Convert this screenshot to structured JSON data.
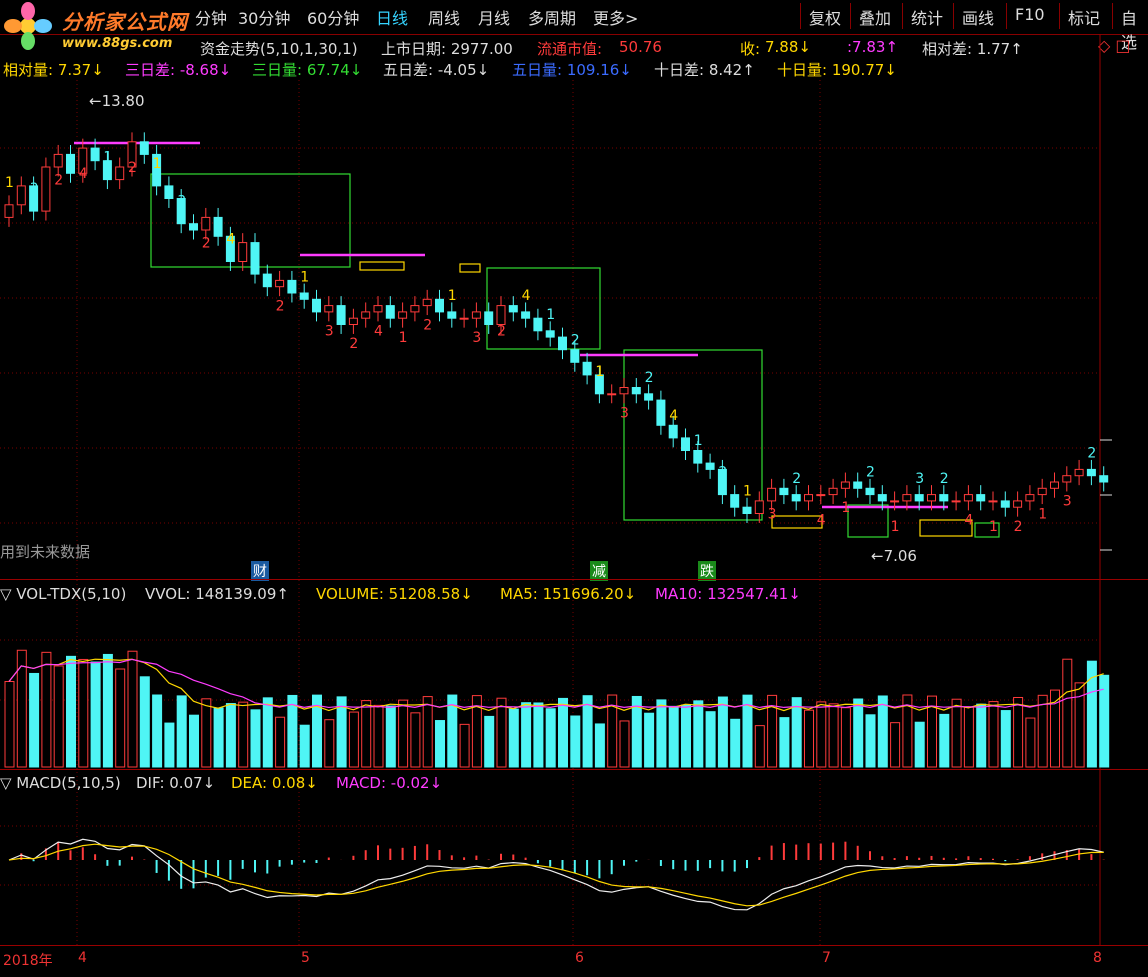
{
  "brand": {
    "name": "分析家公式网",
    "url": "www.88gs.com"
  },
  "period_tabs": [
    {
      "label": "分钟",
      "active": false
    },
    {
      "label": "30分钟",
      "active": false
    },
    {
      "label": "60分钟",
      "active": false
    },
    {
      "label": "日线",
      "active": true
    },
    {
      "label": "周线",
      "active": false
    },
    {
      "label": "月线",
      "active": false
    },
    {
      "label": "多周期",
      "active": false
    },
    {
      "label": "更多>",
      "active": false
    }
  ],
  "right_buttons": [
    "复权",
    "叠加",
    "统计",
    "画线",
    "F10",
    "标记",
    "自选"
  ],
  "main_header": {
    "indicator": "资金走势(5,10,1,30,1)",
    "list_days": "上市日期: 2977.00",
    "float_cap_label": "流通市值:",
    "float_cap_value": "50.76",
    "close_label": "收:",
    "close_value": "7.88↓",
    "price2": ":7.83↑",
    "rel_diff": "相对差: 1.77↑"
  },
  "main_header2": {
    "rel_vol": "相对量: 7.37↓",
    "d3_diff": "三日差: -8.68↓",
    "d3_vol": "三日量: 67.74↓",
    "d5_diff": "五日差: -4.05↓",
    "d5_vol": "五日量: 109.16↓",
    "d10_diff": "十日差: 8.42↑",
    "d10_vol": "十日量: 190.77↓"
  },
  "annotations": {
    "high": "←13.80",
    "low": "←7.06",
    "future_note": "用到未来数据",
    "tag1": "财",
    "tag2": "减",
    "tag3": "跌"
  },
  "vol_header": {
    "name": "▽ VOL-TDX(5,10)",
    "vvol": "VVOL: 148139.09↑",
    "volume": "VOLUME: 51208.58↓",
    "ma5": "MA5: 151696.20↓",
    "ma10": "MA10: 132547.41↓"
  },
  "macd_header": {
    "name": "▽ MACD(5,10,5)",
    "dif": "DIF: 0.07↓",
    "dea": "DEA: 0.08↓",
    "macd": "MACD: -0.02↓"
  },
  "date_axis": [
    "2018年",
    "4",
    "5",
    "6",
    "7",
    "8"
  ],
  "colors": {
    "up": "#ff3b3b",
    "down": "#4ff5f5",
    "ma_magenta": "#ff3cff",
    "box_green": "#33dd33",
    "accent_yellow": "#ffd700"
  }
}
